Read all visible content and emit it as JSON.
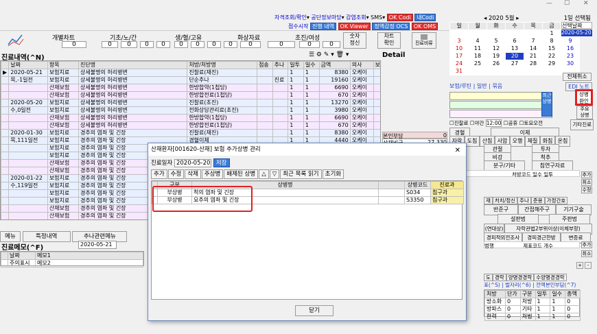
{
  "window": {
    "controls": [
      "—",
      "☐",
      "✕"
    ]
  },
  "topbar": {
    "links": [
      "자격조회/확인",
      "공단정보마당",
      "감염조회",
      "SMS",
      "OK Codi",
      "내Codi"
    ],
    "row2": [
      "점수시작",
      "진행 내역",
      "OK Viewer",
      "정액감정 OCS",
      "OK OMS"
    ]
  },
  "header_cols": [
    "개별차트",
    "기초/노/간",
    "생/혈/고유",
    "화상자료",
    "초진/여성"
  ],
  "header_values": [
    "0",
    "0",
    "0",
    "0",
    "0",
    "0",
    "0",
    "0",
    "0",
    "0",
    "0",
    "0",
    "0"
  ],
  "side_buttons": {
    "visit": "숫자\n정신",
    "chart": "차트\n확인",
    "print": "진료비류"
  },
  "history": {
    "title": "진료내역(^N)",
    "detail_title": "Detail",
    "columns": [
      "날짜",
      "항목",
      "진단명",
      "처방/처방명",
      "점송",
      "추나",
      "일투",
      "일수",
      "금액",
      "의사",
      "보"
    ],
    "rows": [
      {
        "d": "2020-05-21",
        "t": "보험치료",
        "n": "상세불명의 허리병변",
        "p": "진찰료(재진)",
        "j": "",
        "c": "",
        "i": "1",
        "s": "1",
        "m": "8380",
        "doc": "오케이",
        "cls": "rowA"
      },
      {
        "d": "목,-1일전",
        "t": "보험치료",
        "n": "상세불명의 허리병변",
        "p": "단순추나",
        "j": "",
        "c": "진료",
        "i": "1",
        "s": "1",
        "m": "19160",
        "doc": "오케이",
        "cls": "rowA"
      },
      {
        "d": "",
        "t": "산재보험",
        "n": "상세불명의 허리병변",
        "p": "한방합약(1첩당)",
        "j": "",
        "c": "",
        "i": "1",
        "s": "1",
        "m": "6690",
        "doc": "오케이",
        "cls": "rowC"
      },
      {
        "d": "",
        "t": "산재보험",
        "n": "상세불명의 허리병변",
        "p": "한방합전료(1첩당)",
        "j": "",
        "c": "",
        "i": "1",
        "s": "1",
        "m": "670",
        "doc": "오케이",
        "cls": "rowC"
      },
      {
        "d": "2020-05-20",
        "t": "보험치료",
        "n": "상세불명의 허리병변",
        "p": "진찰료(초진)",
        "j": "",
        "c": "",
        "i": "1",
        "s": "1",
        "m": "13270",
        "doc": "오케이",
        "cls": "rowA"
      },
      {
        "d": "수,0일전",
        "t": "보험치료",
        "n": "상세불명의 허리병변",
        "p": "전화상담관리료(초진)",
        "j": "",
        "c": "",
        "i": "1",
        "s": "1",
        "m": "3980",
        "doc": "오케이",
        "cls": "rowA"
      },
      {
        "d": "",
        "t": "산재보험",
        "n": "상세불명의 허리병변",
        "p": "한방합약(1첩당)",
        "j": "",
        "c": "",
        "i": "1",
        "s": "1",
        "m": "6690",
        "doc": "오케이",
        "cls": "rowC"
      },
      {
        "d": "",
        "t": "산재보험",
        "n": "상세불명의 허리병변",
        "p": "한방합전료(1첩당)",
        "j": "",
        "c": "",
        "i": "1",
        "s": "1",
        "m": "670",
        "doc": "오케이",
        "cls": "rowC"
      },
      {
        "d": "2020-01-30",
        "t": "보험치료",
        "n": "경추의 염좌 및 긴장",
        "p": "진찰료(재진)",
        "j": "",
        "c": "",
        "i": "1",
        "s": "1",
        "m": "8380",
        "doc": "오케이",
        "cls": "rowA"
      },
      {
        "d": "목,111일전",
        "t": "보험치료",
        "n": "경추의 염좌 및 긴장",
        "p": "경혈이체",
        "j": "",
        "c": "",
        "i": "1",
        "s": "1",
        "m": "4440",
        "doc": "오케이",
        "cls": "rowA"
      },
      {
        "d": "",
        "t": "보험치료",
        "n": "경추의 염좌 및 긴장",
        "p": "",
        "j": "",
        "c": "",
        "i": "",
        "s": "",
        "m": "",
        "doc": "",
        "cls": "rowA"
      },
      {
        "d": "",
        "t": "보험치료",
        "n": "경추의 염좌 및 긴장",
        "p": "",
        "j": "",
        "c": "",
        "i": "",
        "s": "",
        "m": "",
        "doc": "",
        "cls": "rowA"
      },
      {
        "d": "",
        "t": "산재보험",
        "n": "경추의 염좌 및 긴장",
        "p": "",
        "j": "",
        "c": "",
        "i": "",
        "s": "",
        "m": "",
        "doc": "",
        "cls": "rowC"
      },
      {
        "d": "",
        "t": "산재보험",
        "n": "경추의 염좌 및 긴장",
        "p": "",
        "j": "",
        "c": "",
        "i": "",
        "s": "",
        "m": "",
        "doc": "",
        "cls": "rowC"
      },
      {
        "d": "2020-01-22",
        "t": "보험치료",
        "n": "경추의 염좌 및 긴장",
        "p": "",
        "j": "",
        "c": "",
        "i": "",
        "s": "",
        "m": "",
        "doc": "",
        "cls": "rowA"
      },
      {
        "d": "수,119일전",
        "t": "보험치료",
        "n": "경추의 염좌 및 긴장",
        "p": "",
        "j": "",
        "c": "",
        "i": "",
        "s": "",
        "m": "",
        "doc": "",
        "cls": "rowA"
      },
      {
        "d": "",
        "t": "보험치료",
        "n": "경추의 염좌 및 긴장",
        "p": "",
        "j": "",
        "c": "",
        "i": "",
        "s": "",
        "m": "",
        "doc": "",
        "cls": "rowA"
      },
      {
        "d": "",
        "t": "보험치료",
        "n": "경추의 염좌 및 긴장",
        "p": "",
        "j": "",
        "c": "",
        "i": "",
        "s": "",
        "m": "",
        "doc": "",
        "cls": "rowA"
      },
      {
        "d": "",
        "t": "산재보험",
        "n": "경추의 염좌 및 긴장",
        "p": "",
        "j": "",
        "c": "",
        "i": "",
        "s": "",
        "m": "",
        "doc": "",
        "cls": "rowC"
      },
      {
        "d": "",
        "t": "산재보험",
        "n": "경추의 염좌 및 긴장",
        "p": "",
        "j": "",
        "c": "",
        "i": "",
        "s": "",
        "m": "",
        "doc": "",
        "cls": "rowC"
      }
    ],
    "summary": {
      "label1": "본인부담",
      "val1": "0",
      "label2": "산재비급",
      "val2": "27,330"
    }
  },
  "bottom_tabs": [
    "메뉴",
    "특정내역",
    "추나관련메뉴"
  ],
  "memo": {
    "title": "진료메모(^F)",
    "date": "2020-05-21",
    "cols": [
      "날짜",
      "메모1"
    ],
    "row": [
      "주의표시",
      "메모2"
    ]
  },
  "calendar": {
    "prev": "◂",
    "next": "▸",
    "year_month": "2020 5월",
    "right_label": "1일 선택됨",
    "weekdays": [
      "일",
      "월",
      "화",
      "수",
      "목",
      "금",
      "토"
    ],
    "selected_label": "선택날짜",
    "selected_date": "2020-05-20",
    "weeks": [
      [
        "",
        "",
        "",
        "",
        "",
        "1",
        "2"
      ],
      [
        "3",
        "4",
        "5",
        "6",
        "7",
        "8",
        "9"
      ],
      [
        "10",
        "11",
        "12",
        "13",
        "14",
        "15",
        "16"
      ],
      [
        "17",
        "18",
        "19",
        "20",
        "21",
        "22",
        "23"
      ],
      [
        "24",
        "25",
        "26",
        "27",
        "28",
        "29",
        "30"
      ],
      [
        "31",
        "",
        "",
        "",
        "",
        "",
        ""
      ]
    ],
    "all_cancel": "전체취소",
    "edi": "EDI 노트"
  },
  "right_tabs": [
    "보험/루틴",
    "일반",
    "묶음"
  ],
  "right_side_buttons": [
    "상병\n환인",
    "최근\n상병",
    "주요\n상병",
    "기타진료"
  ],
  "right_checks": [
    "진찰료",
    "야간",
    "12:00",
    "공휴",
    "토요오전"
  ],
  "right_items": [
    "경혈",
    "이체",
    "자락",
    "도침",
    "산침",
    "사암",
    "오행",
    "체질",
    "화침",
    "온침",
    "관절",
    "투자",
    "비강",
    "척추",
    "분구/기타",
    "침연구자료"
  ],
  "right_table_cols": [
    "처방코드",
    "일수",
    "일투",
    "추가"
  ],
  "right_buttons2": [
    "취소",
    "수정"
  ],
  "right_tabs2": [
    "재",
    "처치/정신",
    "추나",
    "준용",
    "가정간호"
  ],
  "right_btn_row": [
    "반준구",
    "간접해주구",
    "기기구술"
  ],
  "right_btn_row2": [
    "설판법",
    "주판법"
  ],
  "right_btn_row3": [
    "(연대상)",
    "자락관법2부위이상(이체부항)"
  ],
  "right_btn_row4": [
    "경피적외전조사",
    "경피경근한방",
    "변증료"
  ],
  "right_table2_cols": [
    "범행",
    "제표코드",
    "개수",
    "추가"
  ],
  "right_small_buttons": [
    "취소",
    "+",
    "-"
  ],
  "right_bottom_tabs": [
    "도",
    "경락",
    "양명경경락",
    "수양명경경락"
  ],
  "right_bottom_tabs2": [
    "표(^S)",
    "벌자리(^6)",
    "전액본인부담(^7)"
  ],
  "right_bottom_table_cols": [
    "처방",
    "단가",
    "구분",
    "일투",
    "일수",
    "총액"
  ],
  "right_bottom_rows": [
    [
      "방소화",
      "0",
      "처방",
      "1",
      "1",
      "0"
    ],
    [
      "방파스",
      "0",
      "기타",
      "1",
      "1",
      "0"
    ],
    [
      "한력",
      "0",
      "처법",
      "1",
      "1",
      "0"
    ]
  ],
  "dialog": {
    "title": "산재환자[001620-산재] 보험 추가상병 관리",
    "close": "✕",
    "date_label": "진료일자",
    "date_value": "2020-05-20",
    "save": "저장",
    "toolbar": [
      "추가",
      "수정",
      "삭제",
      "주상병",
      "배제된 상병",
      "△",
      "▽",
      "최근 목록 읽기",
      "초기화"
    ],
    "columns": [
      "구분",
      "상병명",
      "상병코드",
      "진료과"
    ],
    "rows": [
      {
        "type": "부상병",
        "name": "척의 염좌 및 긴장",
        "code": "S034",
        "dept": "침구과"
      },
      {
        "type": "부상병",
        "name": "요추의 염좌 및 긴장",
        "code": "S3350",
        "dept": "침구과"
      }
    ],
    "close_button": "닫기",
    "highlight_color": "#e02020"
  }
}
